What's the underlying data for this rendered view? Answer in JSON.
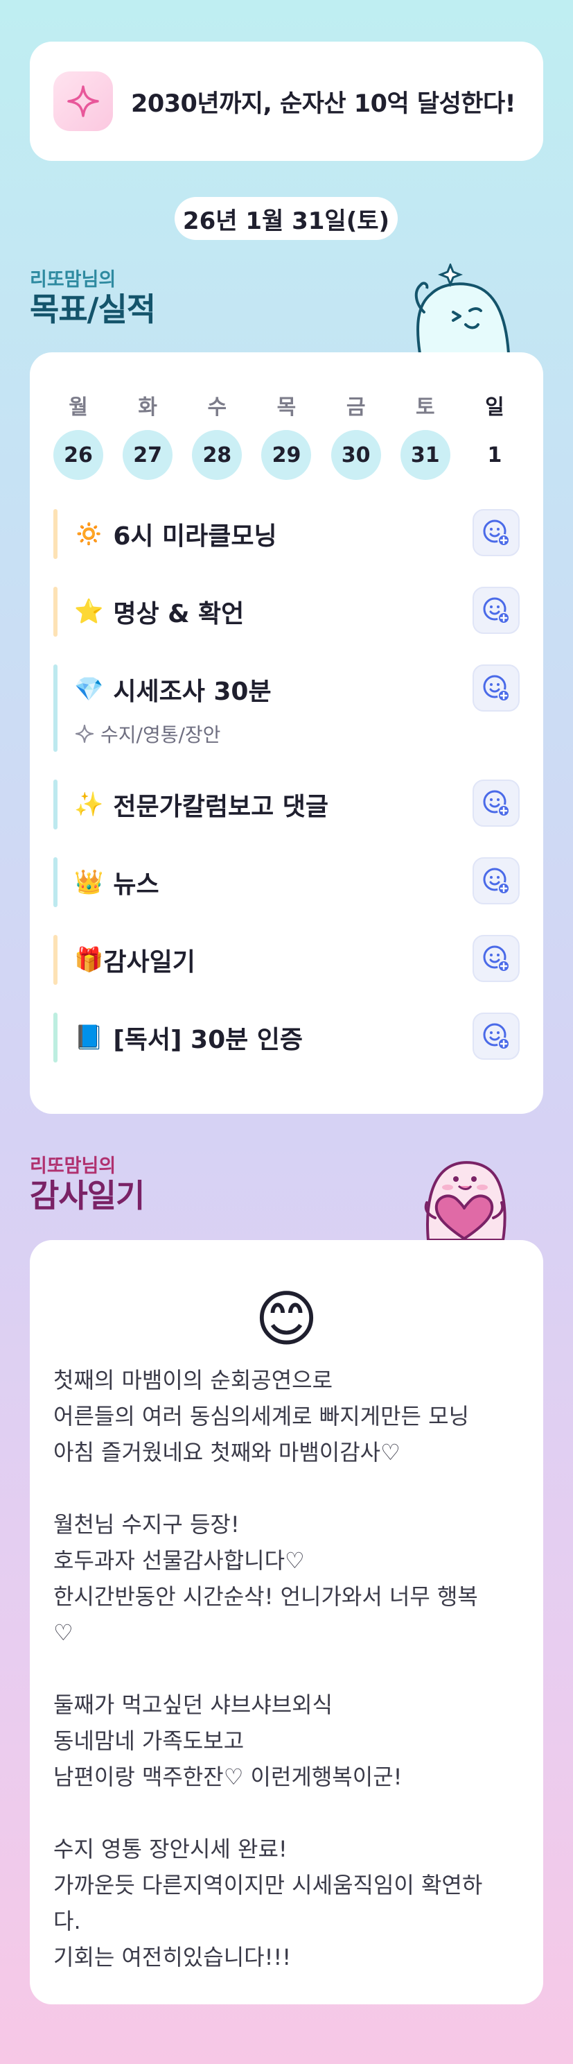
{
  "goal": {
    "icon": "sparkle-icon",
    "text": "2030년까지, 순자산 10억 달성한다!"
  },
  "date": "26년 1월 31일(토)",
  "schedule_section": {
    "subtitle": "리또맘님의",
    "title": "목표/실적",
    "mascot": "ghost-mascot-icon"
  },
  "week": [
    {
      "name": "월",
      "num": "26",
      "highlight": true
    },
    {
      "name": "화",
      "num": "27",
      "highlight": true
    },
    {
      "name": "수",
      "num": "28",
      "highlight": true
    },
    {
      "name": "목",
      "num": "29",
      "highlight": true
    },
    {
      "name": "금",
      "num": "30",
      "highlight": true
    },
    {
      "name": "토",
      "num": "31",
      "highlight": true
    },
    {
      "name": "일",
      "num": "1",
      "highlight": false
    }
  ],
  "tasks": [
    {
      "emoji": "🔅",
      "label": "6시 미라클모닝",
      "bar_color": "#fde2b5"
    },
    {
      "emoji": "⭐",
      "label": "명상 & 확언",
      "bar_color": "#fde2b5"
    },
    {
      "emoji": "💎",
      "label": "시세조사 30분",
      "sub": "수지/영통/장안",
      "bar_color": "#bde9ef"
    },
    {
      "emoji": "✨",
      "label": "전문가칼럼보고 댓글",
      "bar_color": "#bde9ef"
    },
    {
      "emoji": "👑",
      "label": "뉴스",
      "bar_color": "#bde9ef"
    },
    {
      "emoji": "🎁",
      "label": "감사일기",
      "bar_color": "#fde2b5"
    },
    {
      "emoji": "📘",
      "label": "[독서] 30분 인증",
      "bar_color": "#bdeee0"
    }
  ],
  "check_icon": "smile-check-icon",
  "diary_section": {
    "subtitle": "리또맘님의",
    "title": "감사일기",
    "mascot": "heart-mascot-icon"
  },
  "diary": {
    "emoji": "😊",
    "text": "첫째의 마뱀이의 순회공연으로\n어른들의 여러 동심의세계로 빠지게만든 모닝\n아침 즐거웠네요 첫째와 마뱀이감사♡\n\n월천님 수지구 등장!\n호두과자 선물감사합니다♡\n한시간반동안 시간순삭! 언니가와서 너무 행복\n♡\n\n둘째가 먹고싶던 샤브샤브외식\n동네맘네 가족도보고\n남편이랑 맥주한잔♡ 이런게행복이군!\n\n수지 영통 장안시세 완료!\n가까운듯 다른지역이지만 시세움직임이 확연하\n다.\n기회는 여전히있습니다!!!"
  }
}
